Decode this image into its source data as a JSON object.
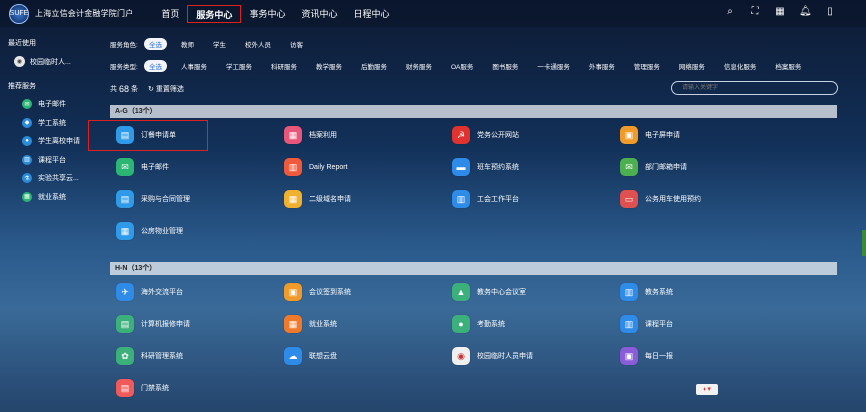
{
  "header": {
    "brand": "上海立信会计金融学院门户",
    "logo_text": "SUFE",
    "nav": [
      "首页",
      "服务中心",
      "事务中心",
      "资讯中心",
      "日程中心"
    ],
    "icons": [
      "search-icon",
      "scan-icon",
      "grid-icon",
      "bell-icon",
      "phone-icon"
    ]
  },
  "sidebar": {
    "recent_title": "最近使用",
    "recent_item": "校园临时人...",
    "recommended_title": "推荐服务",
    "items": [
      {
        "label": "电子邮件",
        "color": "#2bb673"
      },
      {
        "label": "学工系统",
        "color": "#2a8bd8"
      },
      {
        "label": "学生离校申请",
        "color": "#2a8bd8"
      },
      {
        "label": "课程平台",
        "color": "#2a8bd8"
      },
      {
        "label": "实验共享云...",
        "color": "#2a8bd8"
      },
      {
        "label": "就业系统",
        "color": "#2bb673"
      }
    ]
  },
  "filters": {
    "role_title": "服务角色:",
    "roles": [
      "全选",
      "教师",
      "学生",
      "校外人员",
      "访客"
    ],
    "type_title": "服务类型:",
    "types": [
      "全选",
      "人事服务",
      "学工服务",
      "科研服务",
      "教学服务",
      "后勤服务",
      "财务服务",
      "OA服务",
      "图书服务",
      "一卡通服务",
      "外事服务",
      "管理服务",
      "网络服务",
      "信息化服务",
      "档案服务"
    ]
  },
  "results": {
    "count_prefix": "共",
    "count": "68",
    "count_suffix": "条",
    "reset_label": "重置筛选",
    "search_placeholder": "请输入关键字"
  },
  "sections": [
    {
      "title": "A-G（13个）"
    },
    {
      "title": "H-N（13个）"
    }
  ],
  "apps_ag": [
    {
      "label": "订餐申请单",
      "color": "#2f9be8",
      "glyph": "▤"
    },
    {
      "label": "档案利用",
      "color": "#e8577a",
      "glyph": "▦"
    },
    {
      "label": "党务公开网站",
      "color": "#e0332f",
      "glyph": "☭"
    },
    {
      "label": "电子屏申请",
      "color": "#f09a2a",
      "glyph": "▣"
    },
    {
      "label": "电子邮件",
      "color": "#2bb673",
      "glyph": "✉"
    },
    {
      "label": "Daily Report",
      "color": "#f05a3c",
      "glyph": "▥"
    },
    {
      "label": "班车预约系统",
      "color": "#2f8be8",
      "glyph": "▬"
    },
    {
      "label": "部门邮箱申请",
      "color": "#4caf50",
      "glyph": "✉"
    },
    {
      "label": "采购与合同管理",
      "color": "#2f9be8",
      "glyph": "▤"
    },
    {
      "label": "二级域名申请",
      "color": "#f0b030",
      "glyph": "▦"
    },
    {
      "label": "工会工作平台",
      "color": "#2f8be8",
      "glyph": "▥"
    },
    {
      "label": "公务用车使用预约",
      "color": "#e05050",
      "glyph": "▭"
    },
    {
      "label": "公房物业管理",
      "color": "#2f9be8",
      "glyph": "▦"
    }
  ],
  "apps_hn": [
    {
      "label": "海外交流平台",
      "color": "#2f8be8",
      "glyph": "✈"
    },
    {
      "label": "会议签到系统",
      "color": "#f09a2a",
      "glyph": "▣"
    },
    {
      "label": "教务中心会议室",
      "color": "#3bb07a",
      "glyph": "▲"
    },
    {
      "label": "教务系统",
      "color": "#2f8be8",
      "glyph": "▥"
    },
    {
      "label": "计算机报修申请",
      "color": "#3bb07a",
      "glyph": "▤"
    },
    {
      "label": "就业系统",
      "color": "#f07a2a",
      "glyph": "▦"
    },
    {
      "label": "考勤系统",
      "color": "#3bb07a",
      "glyph": "●"
    },
    {
      "label": "课程平台",
      "color": "#2f8be8",
      "glyph": "▥"
    },
    {
      "label": "科研管理系统",
      "color": "#3bb07a",
      "glyph": "✿"
    },
    {
      "label": "联想云盘",
      "color": "#2f8be8",
      "glyph": "☁"
    },
    {
      "label": "校园临时人员申请",
      "color": "#f0f0f0",
      "glyph": "◉"
    },
    {
      "label": "每日一报",
      "color": "#8a5cd8",
      "glyph": "▣"
    },
    {
      "label": "门禁系统",
      "color": "#f05a5a",
      "glyph": "▤"
    }
  ]
}
